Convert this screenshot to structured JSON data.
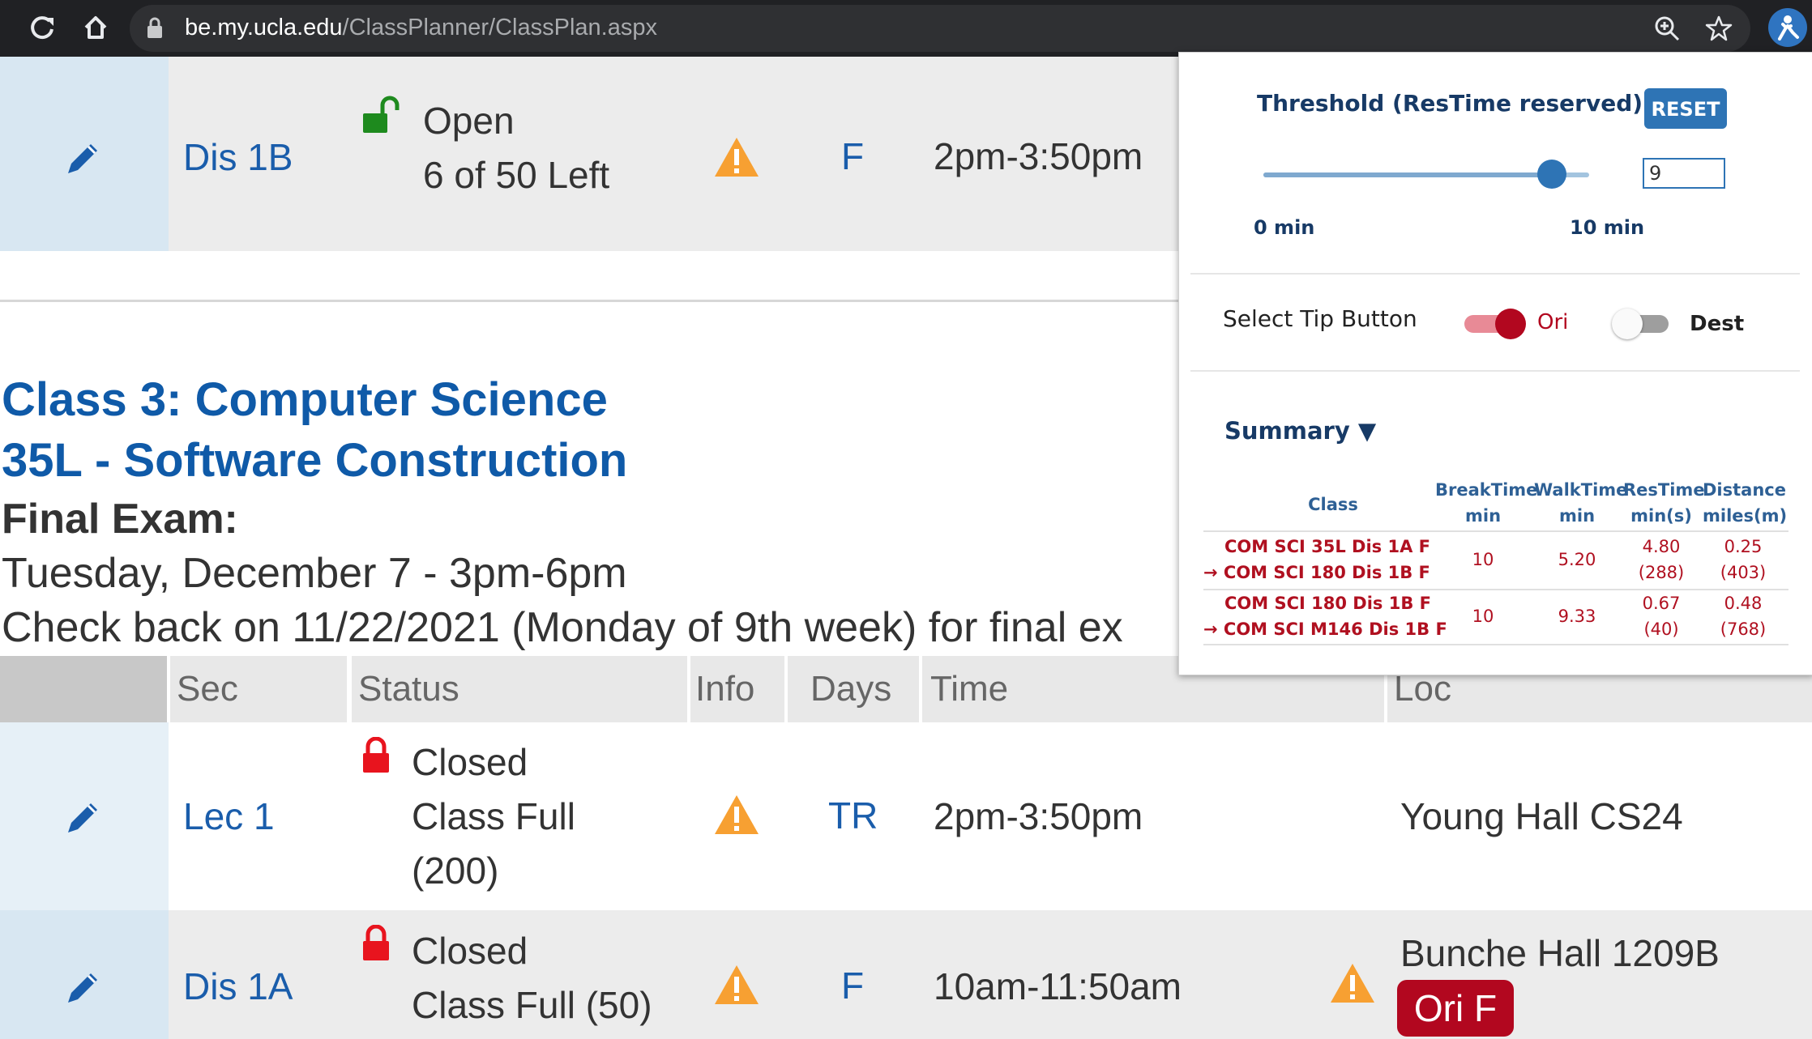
{
  "browser": {
    "url_host": "be.my.ucla.edu",
    "url_path": "/ClassPlanner/ClassPlan.aspx",
    "icons": [
      "reload-icon",
      "home-icon",
      "lock-icon",
      "zoom-icon",
      "star-icon",
      "extension-icon"
    ]
  },
  "row_top": {
    "section": "Dis 1B",
    "status_line1": "Open",
    "status_line2": "6 of 50 Left",
    "days": "F",
    "time": "2pm-3:50pm"
  },
  "class3": {
    "title_line1": "Class 3: Computer Science",
    "title_line2": "35L - Software Construction",
    "final_label": "Final Exam:",
    "final_date": "Tuesday, December 7 - 3pm-6pm",
    "check_back": "Check back on 11/22/2021 (Monday of 9th week) for final ex"
  },
  "table_header": {
    "sec": "Sec",
    "status": "Status",
    "info": "Info",
    "days": "Days",
    "time": "Time",
    "loc": "Loc"
  },
  "row_lec1": {
    "section": "Lec 1",
    "status_line1": "Closed",
    "status_line2": "Class Full",
    "status_line3": "(200)",
    "days": "TR",
    "time": "2pm-3:50pm",
    "loc": "Young Hall CS24"
  },
  "row_dis1a": {
    "section": "Dis 1A",
    "status_line1": "Closed",
    "status_line2": "Class Full (50)",
    "days": "F",
    "time": "10am-11:50am",
    "loc": "Bunche Hall 1209B",
    "badge": "Ori F"
  },
  "popup": {
    "threshold_title": "Threshold (ResTime reserved)",
    "reset_label": "RESET",
    "slider_min_label": "0 min",
    "slider_max_label": "10 min",
    "slider_value_fraction": 0.9,
    "threshold_value": "9",
    "tip_label": "Select Tip Button",
    "toggle_ori_label": "Ori",
    "toggle_dest_label": "Dest",
    "summary_label": "Summary ▼",
    "table": {
      "headers": {
        "class": "Class",
        "break_1": "BreakTime",
        "break_2": "min",
        "walk_1": "WalkTime",
        "walk_2": "min",
        "res_1": "ResTime",
        "res_2": "min(s)",
        "dist_1": "Distance",
        "dist_2": "miles(m)"
      },
      "rows": [
        {
          "from": "COM SCI 35L Dis 1A F",
          "to": "→ COM SCI 180 Dis 1B F",
          "break": "10",
          "walk": "5.20",
          "res": "4.80",
          "res_s": "(288)",
          "dist": "0.25",
          "dist_m": "(403)"
        },
        {
          "from": "COM SCI 180 Dis 1B F",
          "to": "→ COM SCI M146 Dis 1B F",
          "break": "10",
          "walk": "9.33",
          "res": "0.67",
          "res_s": "(40)",
          "dist": "0.48",
          "dist_m": "(768)"
        }
      ]
    }
  },
  "colors": {
    "link_blue": "#1a5dab",
    "title_blue": "#0f5aa8",
    "accent_red": "#b2071f",
    "warning_orange": "#f7a032",
    "open_green": "#1e8a1e",
    "closed_red": "#e8141e"
  }
}
